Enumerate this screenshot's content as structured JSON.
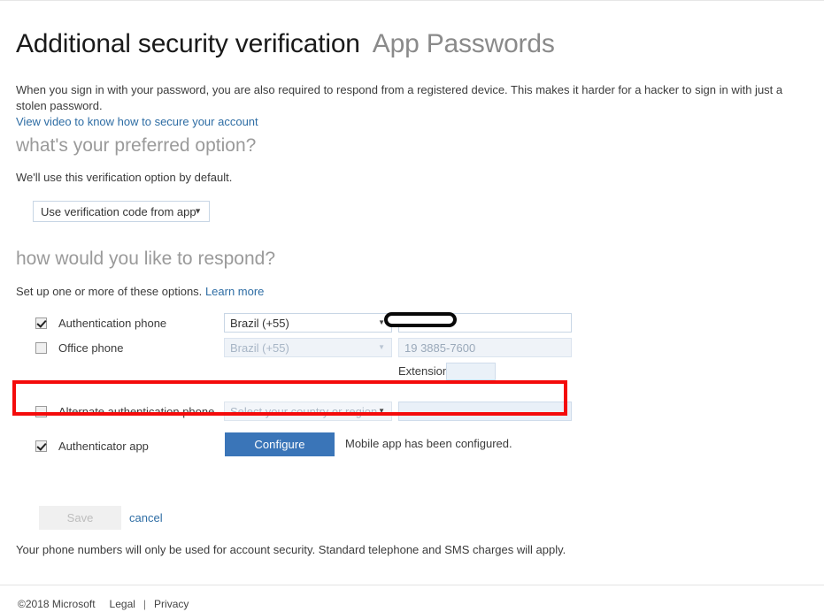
{
  "page": {
    "title_main": "Additional security verification",
    "title_sub": "App Passwords",
    "intro_text": "When you sign in with your password, you are also required to respond from a registered device. This makes it harder for a hacker to sign in with just a stolen password.",
    "intro_link": "View video to know how to secure your account"
  },
  "preferred": {
    "heading": "what's your preferred option?",
    "subtext": "We'll use this verification option by default.",
    "select_value": "Use verification code from app",
    "caret": "▼"
  },
  "respond": {
    "heading": "how would you like to respond?",
    "subtext": "Set up one or more of these options.",
    "learn_more": "Learn more",
    "options": [
      {
        "label": "Authentication phone",
        "checked": true,
        "country": "Brazil (+55)",
        "number": "",
        "disabled": false
      },
      {
        "label": "Office phone",
        "checked": false,
        "country": "Brazil (+55)",
        "number": "19 3885-7600",
        "disabled": true
      },
      {
        "label": "Alternate authentication phone",
        "checked": false,
        "country": "Select your country or region",
        "number": "",
        "disabled": true
      }
    ],
    "extension_label": "Extension",
    "extension_value": "",
    "authenticator": {
      "label": "Authenticator app",
      "checked": true,
      "button_label": "Configure",
      "status": "Mobile app has been configured."
    }
  },
  "actions": {
    "save_label": "Save",
    "cancel_label": "cancel",
    "disclaimer": "Your phone numbers will only be used for account security. Standard telephone and SMS charges will apply."
  },
  "footer": {
    "copyright": "©2018 Microsoft",
    "legal": "Legal",
    "separator": "|",
    "privacy": "Privacy"
  },
  "colors": {
    "accent_blue": "#3a75b8",
    "link_blue": "#2e6da4",
    "highlight_red": "#f40b0b",
    "redaction_black": "#080808"
  }
}
